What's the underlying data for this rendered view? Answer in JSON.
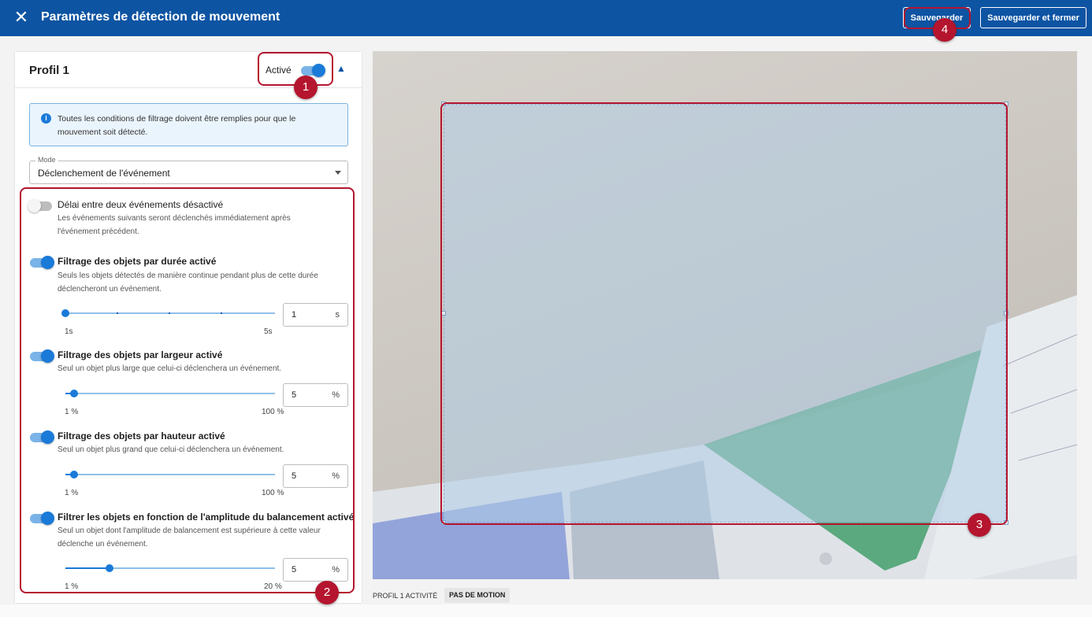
{
  "header": {
    "title": "Paramètres de détection de mouvement",
    "save_label": "Sauvegarder",
    "save_close_label": "Sauvegarder et fermer",
    "close_icon": "close-icon"
  },
  "profile": {
    "title": "Profil 1",
    "active_label": "Activé",
    "active_on": true,
    "collapse_icon": "chevron-up-icon"
  },
  "info": {
    "icon": "info-icon",
    "text": "Toutes les conditions de filtrage doivent être remplies pour que le mouvement soit détecté."
  },
  "mode": {
    "label": "Mode",
    "value": "Déclenchement de l'événement"
  },
  "options": [
    {
      "title": "Délai entre deux événements désactivé",
      "description": "Les événements suivants seront déclenchés immédiatement après l'événement précédent.",
      "enabled": false
    },
    {
      "title": "Filtrage des objets par durée activé",
      "description": "Seuls les objets détectés de manière continue pendant plus de cette durée déclencheront un événement.",
      "enabled": true,
      "slider_min": "1s",
      "slider_max": "5s",
      "slider_position": 0.0,
      "value": "1",
      "unit": "s"
    },
    {
      "title": "Filtrage des objets par largeur activé",
      "description": "Seul un objet plus large que celui-ci déclenchera un événement.",
      "enabled": true,
      "slider_min": "1 %",
      "slider_max": "100 %",
      "slider_position": 0.04,
      "value": "5",
      "unit": "%"
    },
    {
      "title": "Filtrage des objets par hauteur activé",
      "description": "Seul un objet plus grand que celui-ci déclenchera un événement.",
      "enabled": true,
      "slider_min": "1 %",
      "slider_max": "100 %",
      "slider_position": 0.04,
      "value": "5",
      "unit": "%"
    },
    {
      "title": "Filtrer les objets en fonction de l'amplitude du balancement activé",
      "description": "Seul un objet dont l'amplitude de balancement est supérieure à cette valeur déclenche un événement.",
      "enabled": true,
      "slider_min": "1 %",
      "slider_max": "20 %",
      "slider_position": 0.21,
      "value": "5",
      "unit": "%"
    }
  ],
  "status": {
    "profile_state": "PROFIL 1 ACTIVITÉ",
    "motion_state": "PAS DE MOTION"
  },
  "callouts": [
    "1",
    "2",
    "3",
    "4"
  ],
  "colors": {
    "header_bg": "#0d54a3",
    "accent": "#1a7ad8",
    "callout": "#b5152e"
  }
}
